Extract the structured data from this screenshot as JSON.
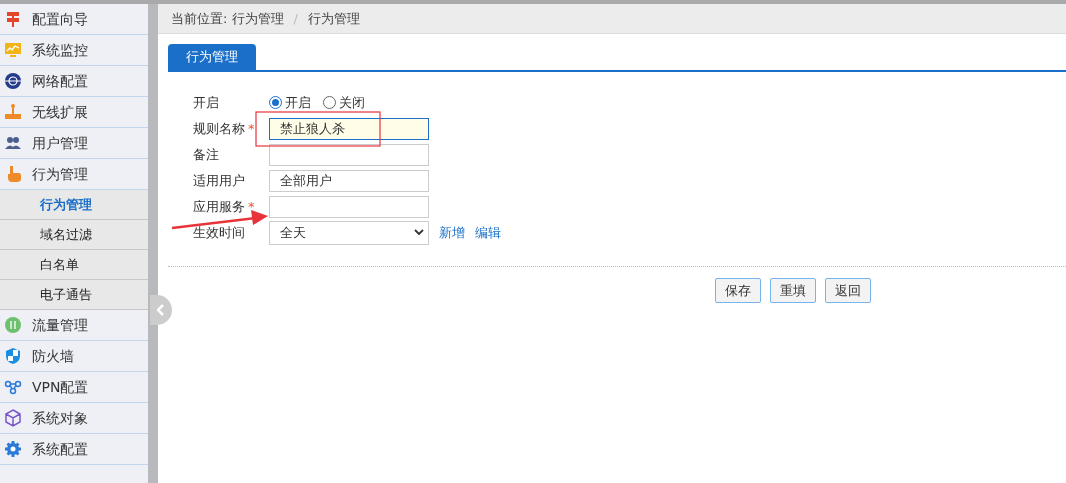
{
  "sidebar": {
    "items": [
      {
        "label": "配置向导"
      },
      {
        "label": "系统监控"
      },
      {
        "label": "网络配置"
      },
      {
        "label": "无线扩展"
      },
      {
        "label": "用户管理"
      },
      {
        "label": "行为管理",
        "children": [
          {
            "label": "行为管理",
            "selected": true
          },
          {
            "label": "域名过滤",
            "selected": false
          },
          {
            "label": "白名单",
            "selected": false
          },
          {
            "label": "电子通告",
            "selected": false
          }
        ]
      },
      {
        "label": "流量管理"
      },
      {
        "label": "防火墙"
      },
      {
        "label": "VPN配置"
      },
      {
        "label": "系统对象"
      },
      {
        "label": "系统配置"
      }
    ]
  },
  "breadcrumb": {
    "items": [
      "当前位置: 行为管理",
      "行为管理"
    ],
    "separator": "/"
  },
  "tabs": [
    {
      "label": "行为管理",
      "selected": true
    }
  ],
  "form": {
    "fields": [
      {
        "kind": "radio",
        "label": "开启",
        "options": [
          {
            "label": "开启",
            "selected": true
          },
          {
            "label": "关闭",
            "selected": false
          }
        ]
      },
      {
        "kind": "text",
        "label": "规则名称",
        "required_mark": "*",
        "value": "禁止狼人杀",
        "focused": true
      },
      {
        "kind": "text",
        "label": "备注",
        "focused": false
      },
      {
        "kind": "text",
        "label": "适用用户",
        "value": "全部用户",
        "focused": false
      },
      {
        "kind": "text",
        "label": "应用服务",
        "required_mark": "*",
        "focused": false
      },
      {
        "kind": "select",
        "label": "生效时间",
        "value": "全天",
        "links": [
          "新增",
          "编辑"
        ]
      }
    ]
  },
  "buttons": [
    "保存",
    "重填",
    "返回"
  ]
}
